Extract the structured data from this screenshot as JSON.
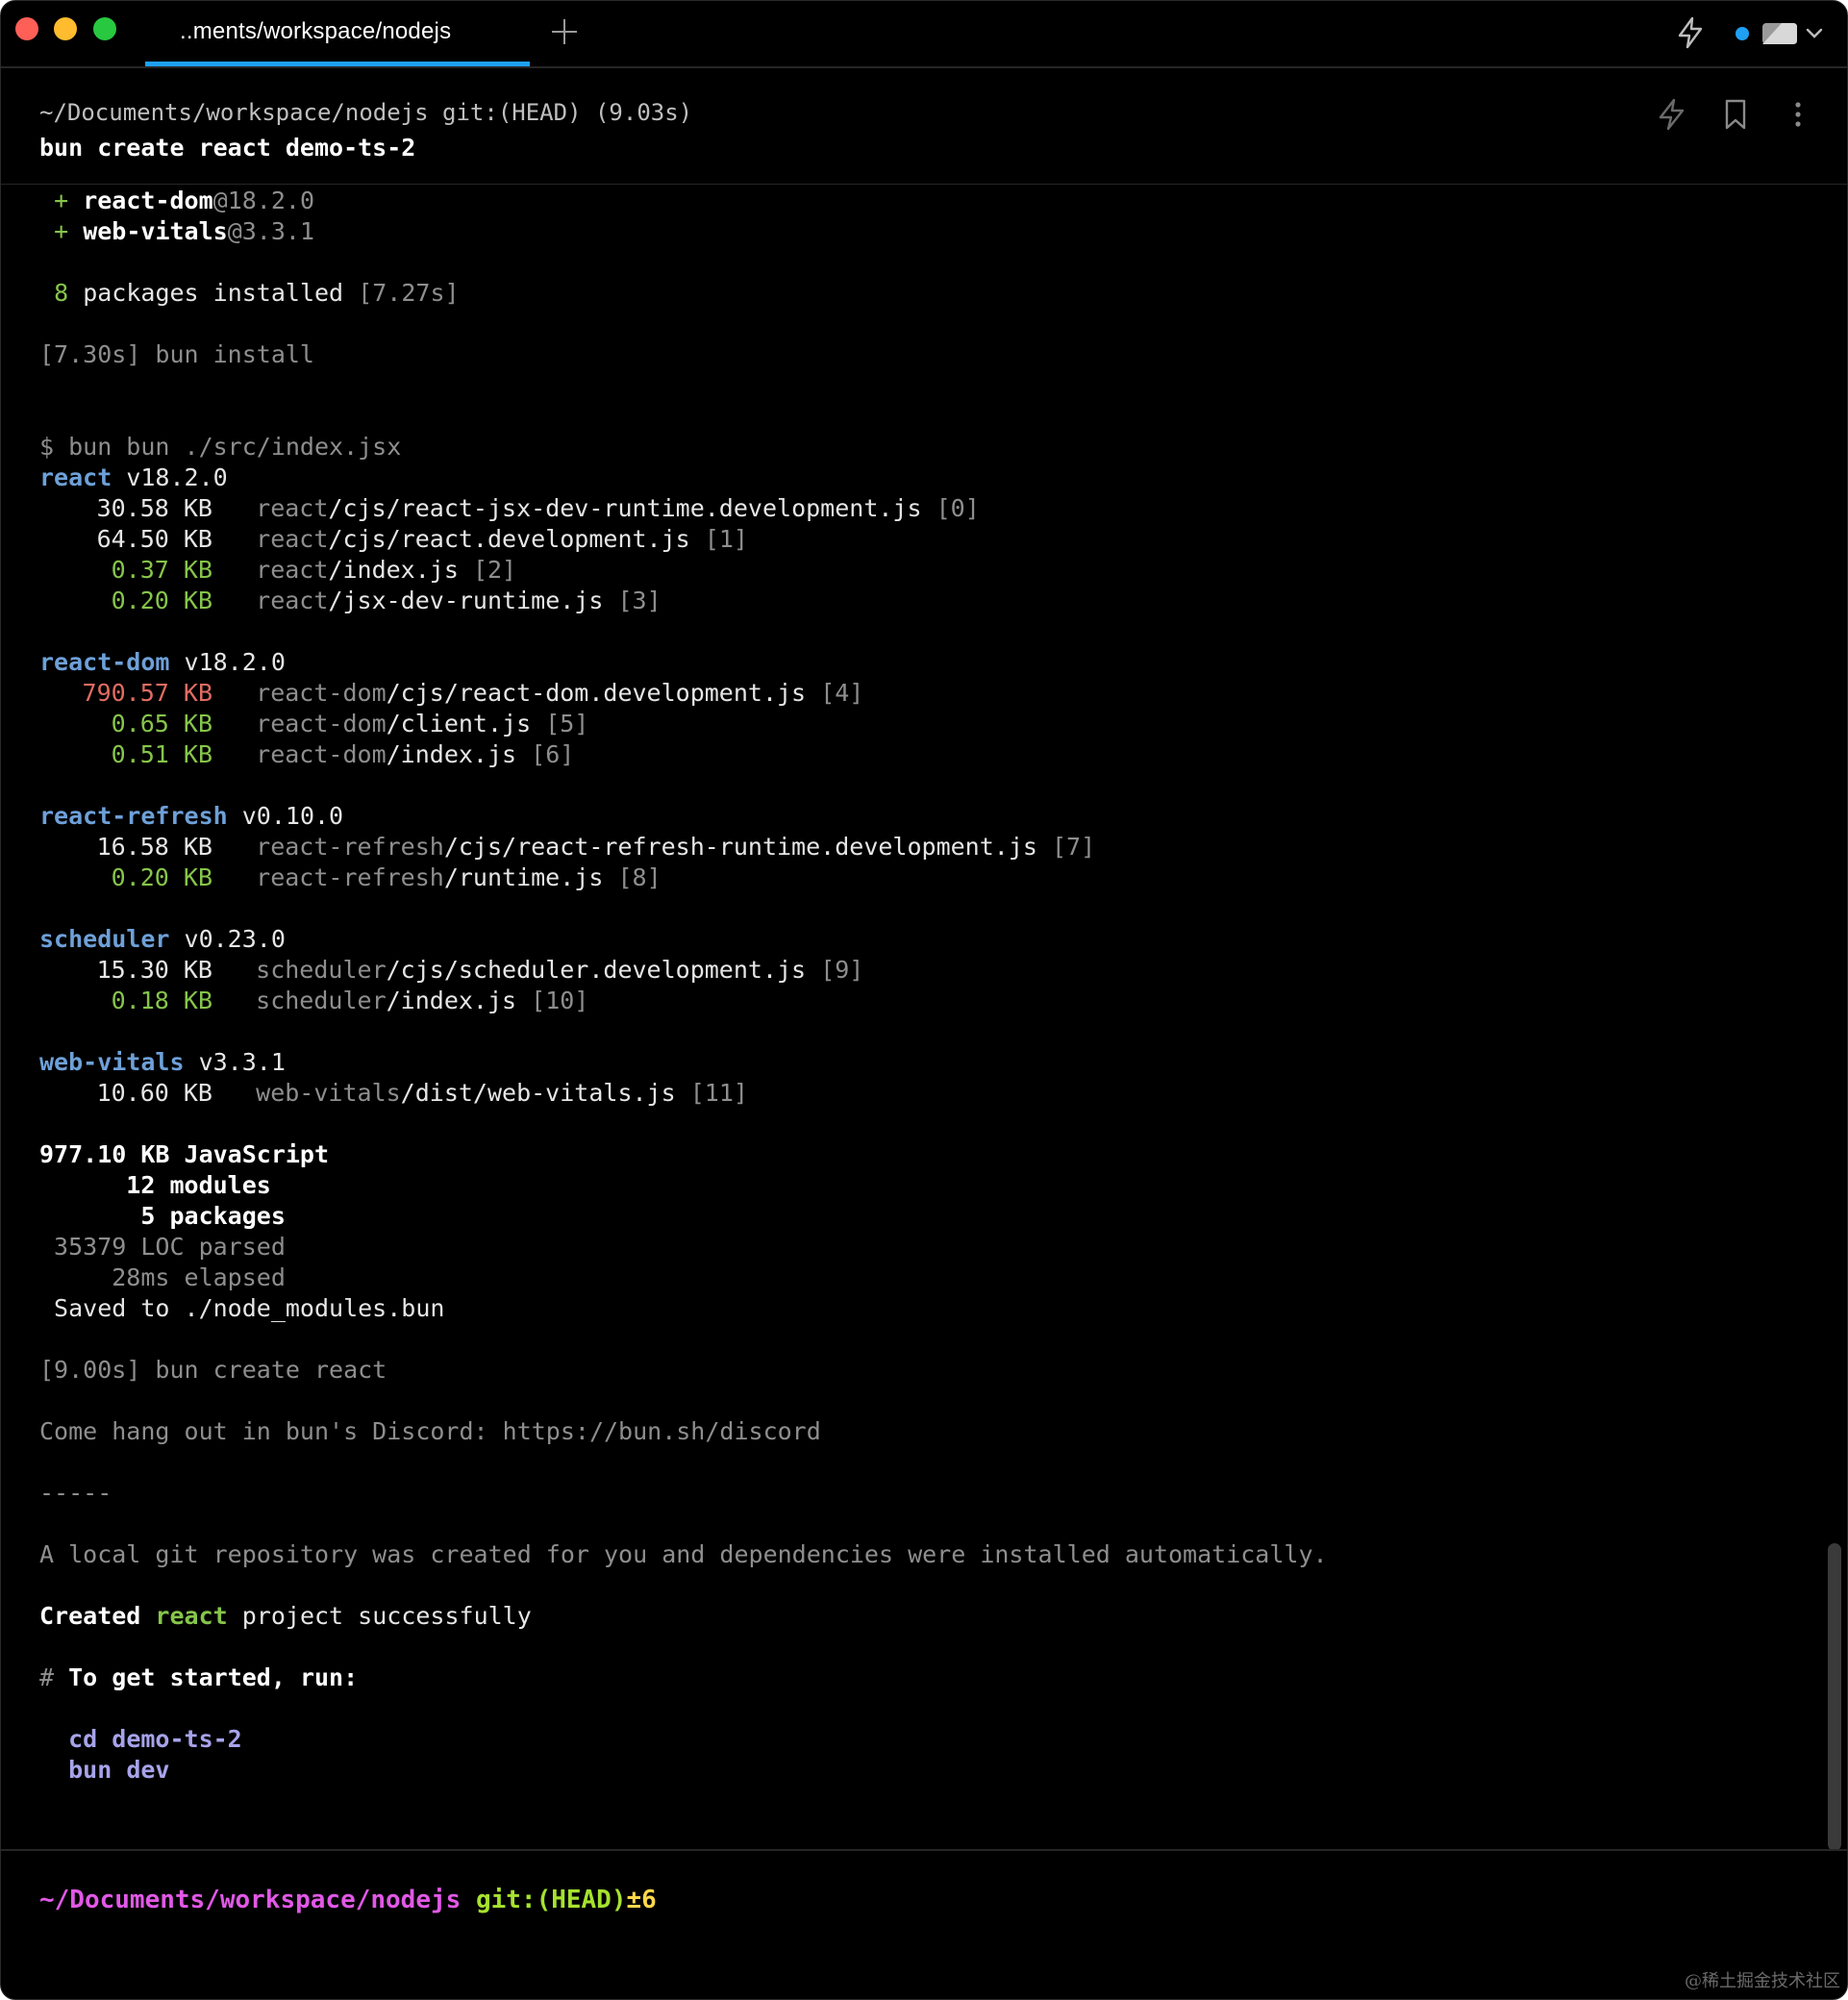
{
  "titlebar": {
    "tab_title": "..ments/workspace/nodejs"
  },
  "header": {
    "meta": "~/Documents/workspace/nodejs git:(HEAD) (9.03s)",
    "command": "bun create react demo-ts-2"
  },
  "install": {
    "deps": [
      {
        "plus": "+",
        "name": "react-dom",
        "version": "@18.2.0"
      },
      {
        "plus": "+",
        "name": "web-vitals",
        "version": "@3.3.1"
      }
    ],
    "count": "8",
    "installed_text": "packages installed",
    "installed_time": "[7.27s]",
    "timing": "[7.30s] bun install"
  },
  "bundle": {
    "command": "$ bun bun ./src/index.jsx",
    "packages": [
      {
        "name": "react",
        "version": "v18.2.0",
        "files": [
          {
            "size": "30.58 KB",
            "pkg": "react",
            "path": "/cjs/react-jsx-dev-runtime.development.js",
            "index": "[0]",
            "level": "normal"
          },
          {
            "size": "64.50 KB",
            "pkg": "react",
            "path": "/cjs/react.development.js",
            "index": "[1]",
            "level": "normal"
          },
          {
            "size": "0.37 KB",
            "pkg": "react",
            "path": "/index.js",
            "index": "[2]",
            "level": "small"
          },
          {
            "size": "0.20 KB",
            "pkg": "react",
            "path": "/jsx-dev-runtime.js",
            "index": "[3]",
            "level": "small"
          }
        ]
      },
      {
        "name": "react-dom",
        "version": "v18.2.0",
        "files": [
          {
            "size": "790.57 KB",
            "pkg": "react-dom",
            "path": "/cjs/react-dom.development.js",
            "index": "[4]",
            "level": "large"
          },
          {
            "size": "0.65 KB",
            "pkg": "react-dom",
            "path": "/client.js",
            "index": "[5]",
            "level": "small"
          },
          {
            "size": "0.51 KB",
            "pkg": "react-dom",
            "path": "/index.js",
            "index": "[6]",
            "level": "small"
          }
        ]
      },
      {
        "name": "react-refresh",
        "version": "v0.10.0",
        "files": [
          {
            "size": "16.58 KB",
            "pkg": "react-refresh",
            "path": "/cjs/react-refresh-runtime.development.js",
            "index": "[7]",
            "level": "normal"
          },
          {
            "size": "0.20 KB",
            "pkg": "react-refresh",
            "path": "/runtime.js",
            "index": "[8]",
            "level": "small"
          }
        ]
      },
      {
        "name": "scheduler",
        "version": "v0.23.0",
        "files": [
          {
            "size": "15.30 KB",
            "pkg": "scheduler",
            "path": "/cjs/scheduler.development.js",
            "index": "[9]",
            "level": "normal"
          },
          {
            "size": "0.18 KB",
            "pkg": "scheduler",
            "path": "/index.js",
            "index": "[10]",
            "level": "small"
          }
        ]
      },
      {
        "name": "web-vitals",
        "version": "v3.3.1",
        "files": [
          {
            "size": "10.60 KB",
            "pkg": "web-vitals",
            "path": "/dist/web-vitals.js",
            "index": "[11]",
            "level": "normal"
          }
        ]
      }
    ],
    "summary": {
      "total": "977.10 KB JavaScript",
      "modules": "      12 modules",
      "packages": "       5 packages",
      "loc": " 35379 LOC parsed",
      "elapsed": "     28ms elapsed",
      "saved": " Saved to ./node_modules.bun"
    }
  },
  "footer": {
    "timing": "[9.00s] bun create react",
    "discord": "Come hang out in bun's Discord: https://bun.sh/discord",
    "separator": "-----",
    "git_note": "A local git repository was created for you and dependencies were installed automatically.",
    "created_prefix": "Created",
    "created_name": "react",
    "created_suffix": "project successfully",
    "hash": "#",
    "get_started": "To get started, run:",
    "cmd1": "cd demo-ts-2",
    "cmd2": "bun dev"
  },
  "prompt": {
    "path": "~/Documents/workspace/nodejs",
    "git": "git:(HEAD)",
    "git_status": "±6"
  },
  "watermark": "@稀土掘金技术社区",
  "colors": {
    "tab_accent": "#1ea0f5",
    "small_size": "#86c54a",
    "large_size": "#e06c62",
    "package_name": "#6ea0d8",
    "prompt_path": "#e158e6",
    "prompt_git": "#a6e22e"
  },
  "icons": [
    "plus-icon",
    "bolt-icon",
    "theme-toggle-icon",
    "chevron-down-icon",
    "bookmark-icon",
    "kebab-menu-icon"
  ]
}
